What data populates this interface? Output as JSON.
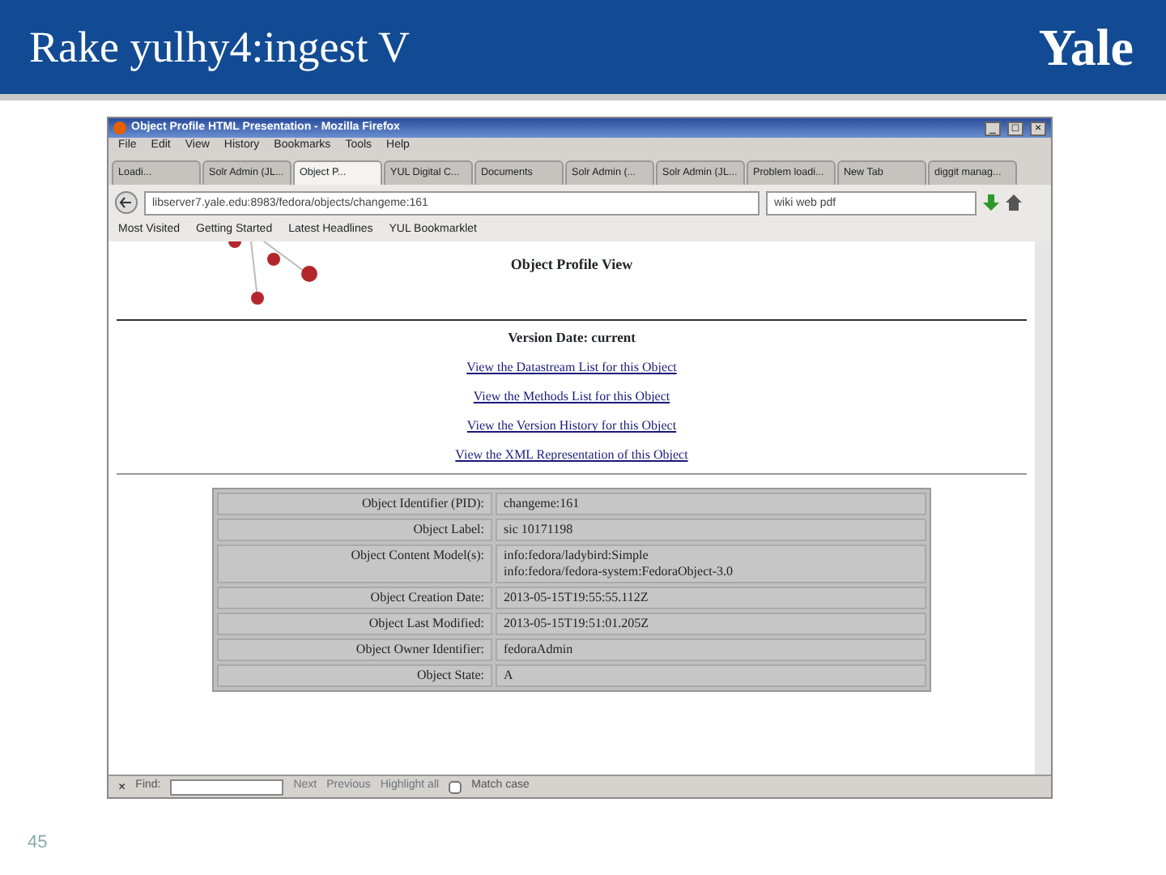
{
  "slide": {
    "title": "Rake yulhy4:ingest V",
    "logo": "Yale",
    "page_number": "45"
  },
  "browser": {
    "title": "Object Profile HTML Presentation - Mozilla Firefox",
    "window_controls": [
      "_",
      "□",
      "×"
    ],
    "menu": [
      "File",
      "Edit",
      "View",
      "History",
      "Bookmarks",
      "Tools",
      "Help"
    ],
    "tabs": [
      {
        "label": "Loadi...",
        "selected": false
      },
      {
        "label": "Solr Admin (JL...",
        "selected": false
      },
      {
        "label": "Object P...",
        "selected": true
      },
      {
        "label": "YUL Digital C...",
        "selected": false
      },
      {
        "label": "Documents",
        "selected": false
      },
      {
        "label": "Solr Admin (...",
        "selected": false
      },
      {
        "label": "Solr Admin (JL...",
        "selected": false
      },
      {
        "label": "Problem loadi...",
        "selected": false
      },
      {
        "label": "New Tab",
        "selected": false
      },
      {
        "label": "diggit manag...",
        "selected": false
      }
    ],
    "url": "libserver7.yale.edu:8983/fedora/objects/changeme:161",
    "search": "wiki web pdf",
    "bookmarks": [
      "Most Visited",
      "Getting Started",
      "Latest Headlines",
      "YUL Bookmarklet"
    ],
    "page": {
      "heading": "Object Profile View",
      "version": "Version Date: current",
      "links": [
        "View the Datastream List for this Object",
        "View the Methods List for this Object",
        "View the Version History for this Object",
        "View the XML Representation of this Object"
      ],
      "table": [
        {
          "label": "Object Identifier (PID):",
          "value": [
            "changeme:161"
          ]
        },
        {
          "label": "Object Label:",
          "value": [
            "sic 10171198"
          ]
        },
        {
          "label": "Object Content Model(s):",
          "value": [
            "info:fedora/ladybird:Simple",
            "info:fedora/fedora-system:FedoraObject-3.0"
          ]
        },
        {
          "label": "Object Creation Date:",
          "value": [
            "2013-05-15T19:55:55.112Z"
          ]
        },
        {
          "label": "Object Last Modified:",
          "value": [
            "2013-05-15T19:51:01.205Z"
          ]
        },
        {
          "label": "Object Owner Identifier:",
          "value": [
            "fedoraAdmin"
          ]
        },
        {
          "label": "Object State:",
          "value": [
            "A"
          ]
        }
      ]
    },
    "find_bar": {
      "close": "×",
      "label": "Find:",
      "next": "Next",
      "previous": "Previous",
      "highlight": "Highlight all",
      "match_case": {
        "label": "Match case",
        "checked": false
      }
    }
  }
}
